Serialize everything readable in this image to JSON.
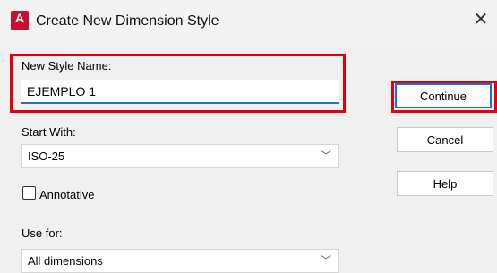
{
  "window": {
    "title": "Create New Dimension Style",
    "app_icon_letter": "A"
  },
  "form": {
    "new_style_name_label": "New Style Name:",
    "new_style_name_value": "EJEMPLO 1",
    "start_with_label": "Start With:",
    "start_with_value": "ISO-25",
    "annotative_label": "Annotative",
    "annotative_checked": false,
    "use_for_label": "Use for:",
    "use_for_value": "All dimensions"
  },
  "buttons": {
    "continue": "Continue",
    "cancel": "Cancel",
    "help": "Help"
  },
  "icons": {
    "close": "close-icon",
    "dropdown": "chevron-down-icon",
    "app": "autocad-app-icon"
  },
  "colors": {
    "highlight": "#e00010",
    "focus_underline": "#2b6cc4",
    "default_button_border": "#1a6fd1",
    "app_icon": "#c8102e"
  }
}
